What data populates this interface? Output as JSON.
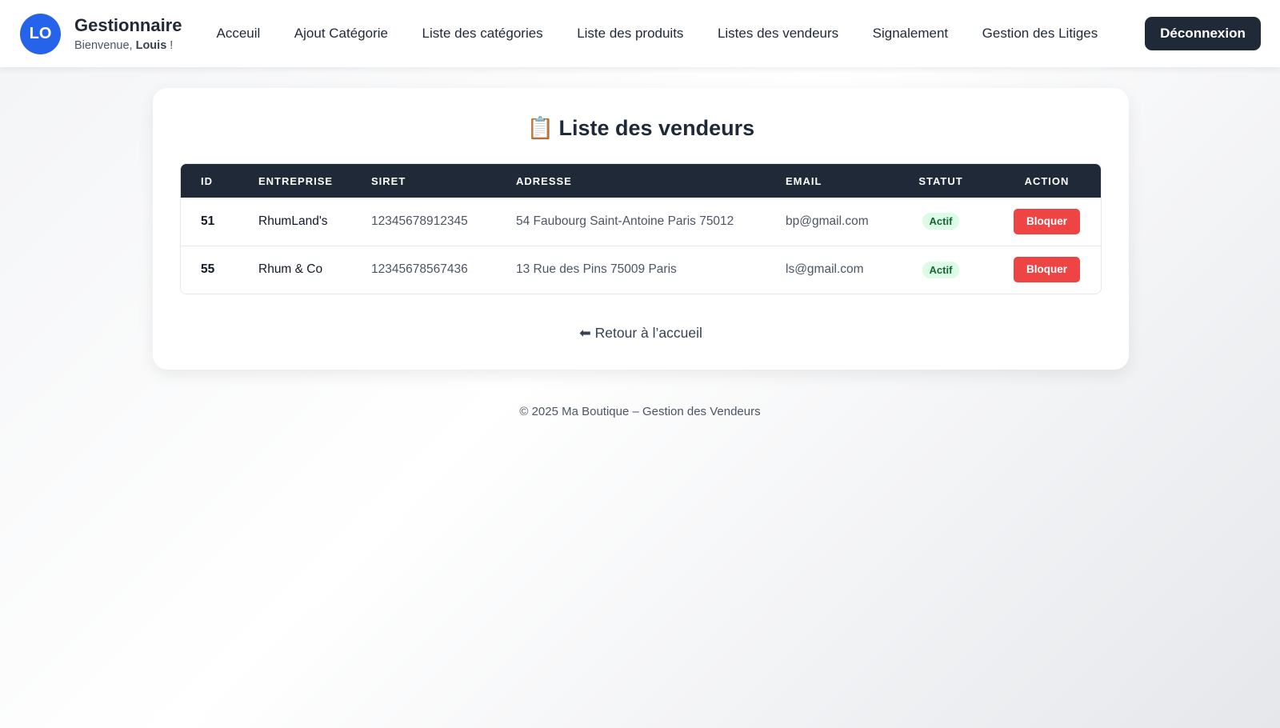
{
  "header": {
    "avatar_initials": "LO",
    "title": "Gestionnaire",
    "welcome_prefix": "Bienvenue,",
    "user_name": "Louis",
    "welcome_suffix": "!",
    "nav": [
      {
        "label": "Acceuil"
      },
      {
        "label": "Ajout Catégorie"
      },
      {
        "label": "Liste des catégories"
      },
      {
        "label": "Liste des produits"
      },
      {
        "label": "Listes des vendeurs"
      },
      {
        "label": "Signalement"
      },
      {
        "label": "Gestion des Litiges"
      }
    ],
    "logout_label": "Déconnexion"
  },
  "main": {
    "title_emoji": "📋",
    "title": "Liste des vendeurs",
    "columns": [
      "ID",
      "ENTREPRISE",
      "SIRET",
      "ADRESSE",
      "EMAIL",
      "STATUT",
      "ACTION"
    ],
    "rows": [
      {
        "id": "51",
        "company": "RhumLand's",
        "siret": "12345678912345",
        "address": "54 Faubourg Saint-Antoine Paris 75012",
        "email": "bp@gmail.com",
        "status": "Actif",
        "action": "Bloquer"
      },
      {
        "id": "55",
        "company": "Rhum & Co",
        "siret": "12345678567436",
        "address": "13 Rue des Pins 75009 Paris",
        "email": "ls@gmail.com",
        "status": "Actif",
        "action": "Bloquer"
      }
    ],
    "back_label": "⬅ Retour à l’accueil"
  },
  "footer": {
    "text": "© 2025 Ma Boutique – Gestion des Vendeurs"
  },
  "colors": {
    "header_dark": "#1f2937",
    "avatar_blue": "#2563eb",
    "danger_red": "#ef4444",
    "status_green_bg": "#dcfce7",
    "status_green_text": "#166534"
  }
}
